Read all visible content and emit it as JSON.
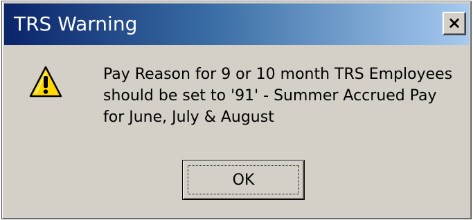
{
  "window": {
    "title": "TRS Warning",
    "close_label": "×"
  },
  "message": {
    "icon": "warning-icon",
    "lines": [
      "Pay Reason for 9 or 10 month TRS Employees",
      "should be set to '91' - Summer Accrued Pay",
      "for June, July & August"
    ]
  },
  "buttons": {
    "ok_label": "OK"
  },
  "colors": {
    "titlebar_start": "#0a246a",
    "titlebar_end": "#a6caf0",
    "dialog_face": "#d4d0c8",
    "icon_fill": "#ffd800"
  }
}
